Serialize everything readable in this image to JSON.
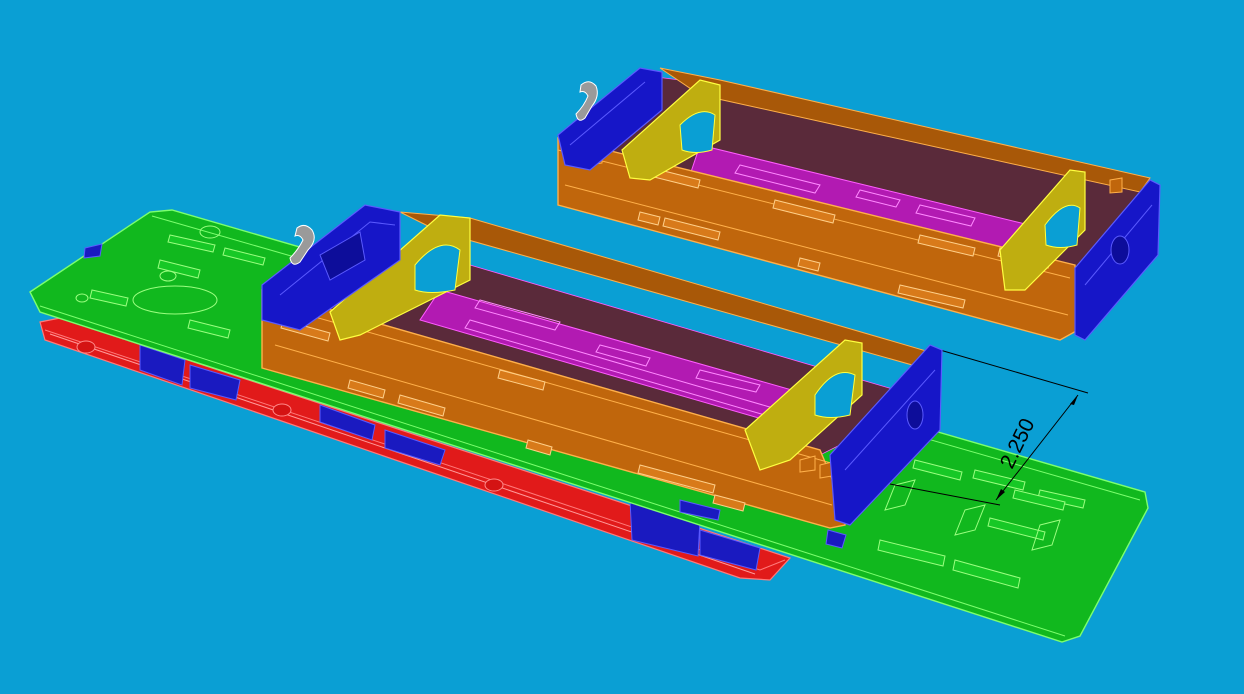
{
  "viewport": {
    "background": "#0a9fd4",
    "dimension_label": "2.250"
  },
  "colors": {
    "base_plate_green": "#11b81e",
    "base_plate_green_edge": "#7cff6e",
    "base_plate_red": "#e11a1a",
    "base_plate_red_edge": "#ff7a7a",
    "side_panel_orange": "#c0660c",
    "side_panel_orange_edge": "#ffb04a",
    "end_panel_blue": "#1616c8",
    "end_panel_blue_edge": "#5a5aff",
    "bulkhead_yellow": "#bfae10",
    "bulkhead_yellow_edge": "#ffff40",
    "floor_magenta": "#b21ab2",
    "floor_magenta_edge": "#ff5cff",
    "coupler_grey": "#9a9a9a"
  },
  "icons": [
    "coupler-hook-icon",
    "coupler-hook-icon"
  ]
}
